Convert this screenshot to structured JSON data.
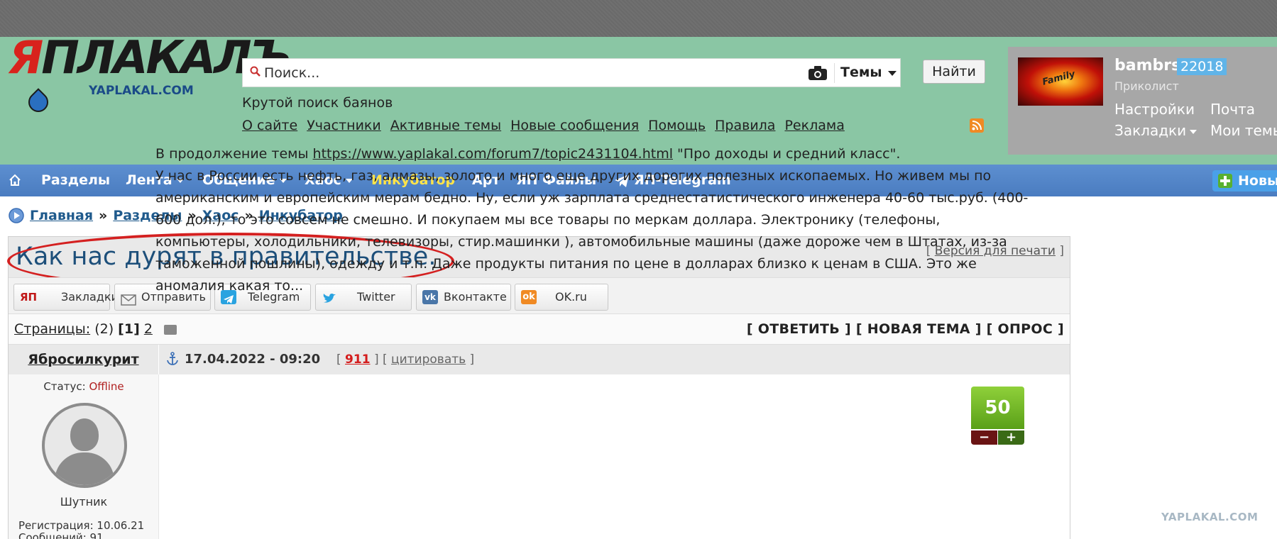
{
  "logo": {
    "main": "ЯПЛАКАЛЪ",
    "sub": "YAPLAKAL.COM"
  },
  "search": {
    "placeholder": "Поиск...",
    "scope": "Темы",
    "button": "Найти",
    "tagline": "Крутой поиск баянов"
  },
  "topnav": [
    "О сайте",
    "Участники",
    "Активные темы",
    "Новые сообщения",
    "Помощь",
    "Правила",
    "Реклама"
  ],
  "user": {
    "name": "bambrs",
    "rating": "22018",
    "rank": "Приколист",
    "avatar_text": "Family",
    "links": {
      "settings": "Настройки",
      "mail": "Почта",
      "bookmarks": "Закладки",
      "my_topics": "Мои темы"
    }
  },
  "mainnav": {
    "sections": "Разделы",
    "feed": "Лента",
    "talk": "Общение",
    "chaos": "Хаос",
    "incubator": "Инкубатор",
    "art": "Арт",
    "files": "ЯП Файлы",
    "telegram": "ЯП-Telegram",
    "new": "Новы"
  },
  "breadcrumb": [
    "Главная",
    "Разделы",
    "Хаос",
    "Инкубатор"
  ],
  "breadcrumb_sep": "»",
  "topic": {
    "title": "Как нас дурят в правительстве.",
    "print_link": "Версия для печати",
    "share": [
      "Закладки",
      "Отправить",
      "Telegram",
      "Twitter",
      "Вконтакте",
      "OK.ru"
    ],
    "pages_label": "Страницы:",
    "pages_total": "(2)",
    "page_current": "[1]",
    "page_next": "2",
    "actions": "[ ОТВЕТИТЬ ] [ НОВАЯ ТЕМА ] [ ОПРОС ]"
  },
  "post": {
    "author": "Ябросилкурит",
    "date": "17.04.2022 - 09:20",
    "number": "911",
    "cite": "цитировать",
    "status_label": "Статус:",
    "status_value": "Offline",
    "rank": "Шутник",
    "registration": "Регистрация: 10.06.21",
    "messages": "Сообщений: 91",
    "text_intro": "В продолжение темы ",
    "link": "https://www.yaplakal.com/forum7/topic2431104.html",
    "text_after_link": " \"Про доходы и средний класс\".",
    "text_body": "У нас в России есть нефть, газ, алмазы, золото и много еще других дорогих полезных ископаемых. Но живем мы по американским и европейским мерам бедно. Ну, если уж зарплата среднестатистического инженера 40-60 тыс.руб. (400-600 дол.), то это совсем не смешно. И покупаем мы все товары по меркам доллара. Электронику (телефоны, компьютеры, холодильники, телевизоры, стир.машинки ), автомобильные машины (даже дороже чем в Штатах, из-за таможенной пошлины), одежду и т.п. Даже продукты питания по цене в долларах близко к ценам в США. Это же аномалия какая то...",
    "rating": "50",
    "minus": "−",
    "plus": "+"
  },
  "watermark": "YAPLAKAL.COM",
  "colors": {
    "header": "#8ac6a4",
    "nav": "#4f82c4",
    "incubator": "#ffe44a",
    "title": "#1d4f7a",
    "oval": "#d42020"
  }
}
